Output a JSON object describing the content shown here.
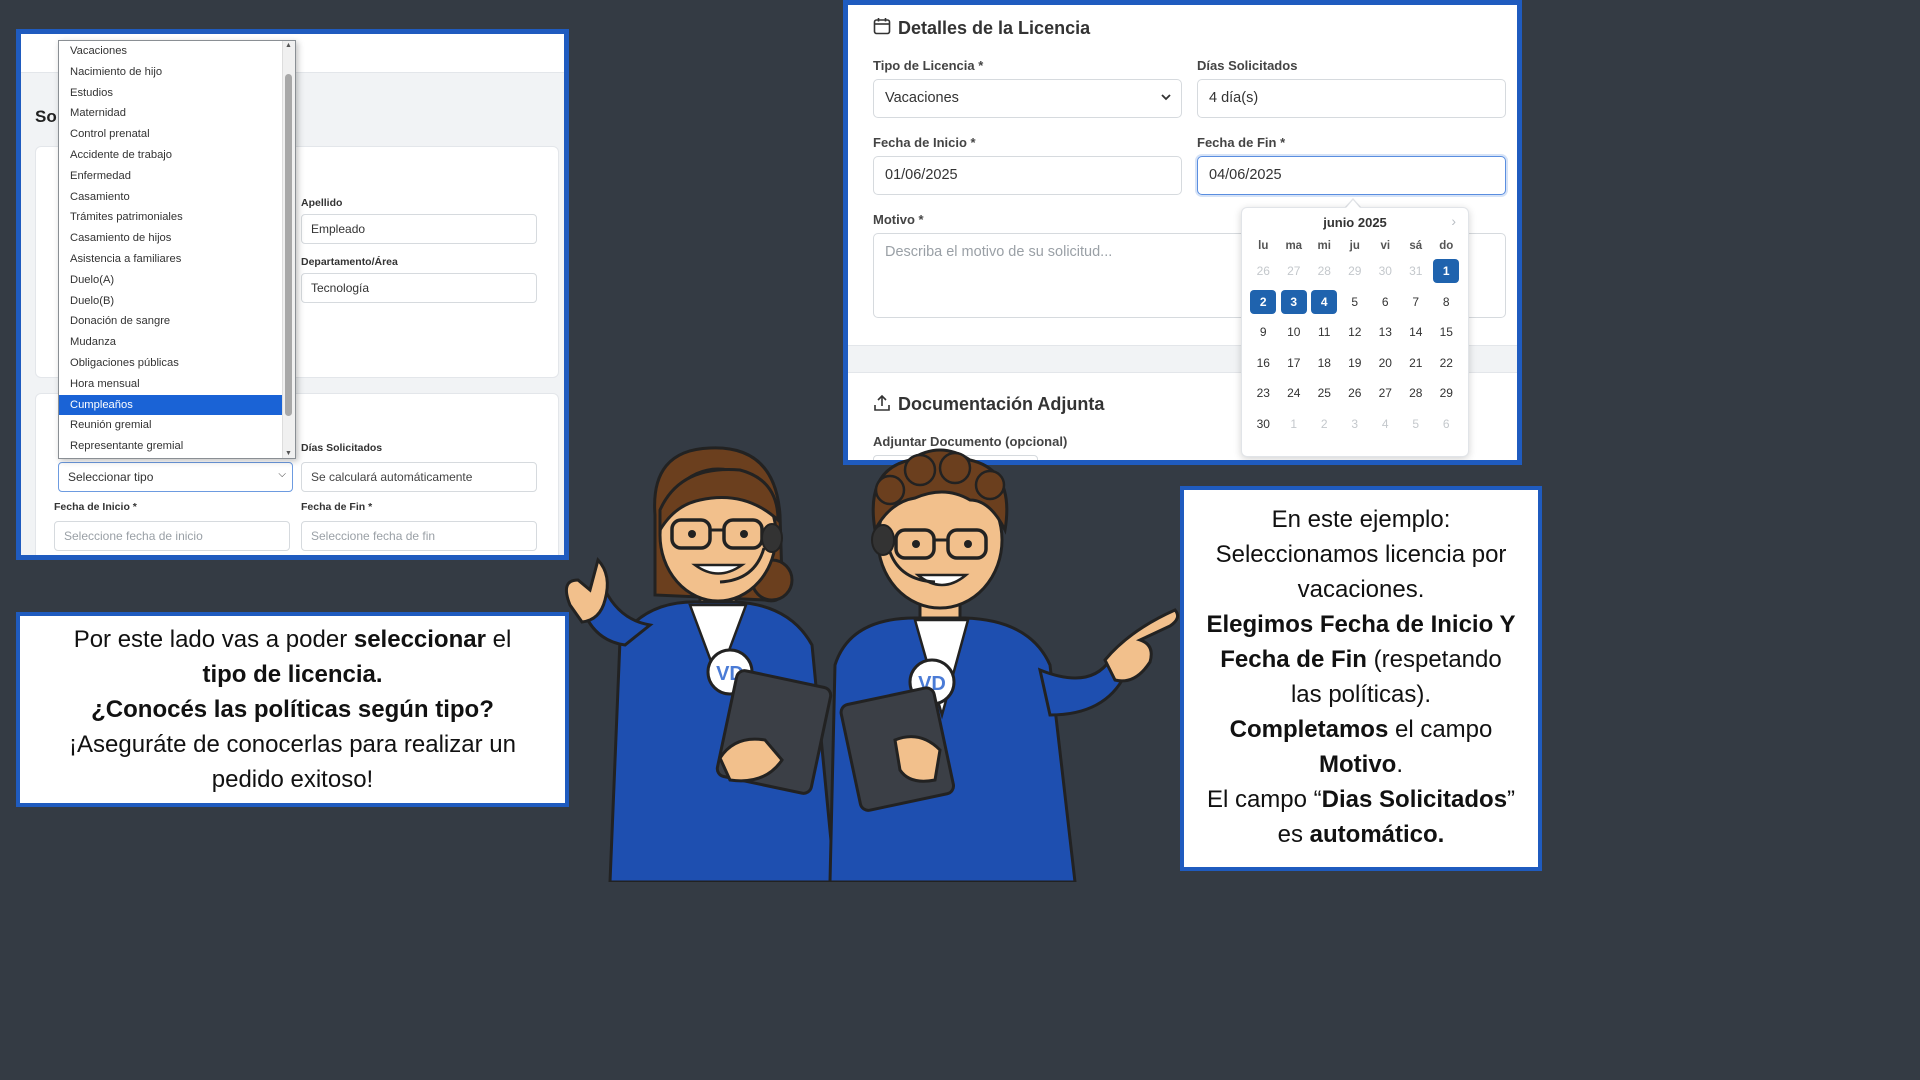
{
  "left_shot": {
    "page_title_fragment": "So",
    "dropdown_options": [
      "Vacaciones",
      "Nacimiento de hijo",
      "Estudios",
      "Maternidad",
      "Control prenatal",
      "Accidente de trabajo",
      "Enfermedad",
      "Casamiento",
      "Trámites patrimoniales",
      "Casamiento de hijos",
      "Asistencia a familiares",
      "Duelo(A)",
      "Duelo(B)",
      "Donación de sangre",
      "Mudanza",
      "Obligaciones públicas",
      "Hora mensual",
      "Cumpleaños",
      "Reunión gremial",
      "Representante gremial"
    ],
    "highlighted_option": "Cumpleaños",
    "apellido_label": "Apellido",
    "apellido_value": "Empleado",
    "departamento_label": "Departamento/Área",
    "departamento_value": "Tecnología",
    "tipo_select_value": "Seleccionar tipo",
    "dias_label": "Días Solicitados",
    "dias_placeholder": "Se calculará automáticamente",
    "fecha_inicio_label": "Fecha de Inicio *",
    "fecha_inicio_placeholder": "Seleccione fecha de inicio",
    "fecha_fin_label": "Fecha de Fin *",
    "fecha_fin_placeholder": "Seleccione fecha de fin"
  },
  "right_shot": {
    "section_title": "Detalles de la Licencia",
    "tipo_label": "Tipo de Licencia *",
    "tipo_value": "Vacaciones",
    "dias_label": "Días Solicitados",
    "dias_value": "4 día(s)",
    "fecha_inicio_label": "Fecha de Inicio *",
    "fecha_inicio_value": "01/06/2025",
    "fecha_fin_label": "Fecha de Fin *",
    "fecha_fin_value": "04/06/2025",
    "motivo_label": "Motivo *",
    "motivo_placeholder": "Describa el motivo de su solicitud...",
    "doc_section_title": "Documentación Adjunta",
    "doc_label": "Adjuntar Documento (opcional)",
    "calendar": {
      "month_title": "junio 2025",
      "weekdays": [
        "lu",
        "ma",
        "mi",
        "ju",
        "vi",
        "sá",
        "do"
      ],
      "weeks": [
        [
          "26",
          "27",
          "28",
          "29",
          "30",
          "31",
          "1"
        ],
        [
          "2",
          "3",
          "4",
          "5",
          "6",
          "7",
          "8"
        ],
        [
          "9",
          "10",
          "11",
          "12",
          "13",
          "14",
          "15"
        ],
        [
          "16",
          "17",
          "18",
          "19",
          "20",
          "21",
          "22"
        ],
        [
          "23",
          "24",
          "25",
          "26",
          "27",
          "28",
          "29"
        ],
        [
          "30",
          "1",
          "2",
          "3",
          "4",
          "5",
          "6"
        ]
      ],
      "muted_first_week_count": 6,
      "selected_days": [
        "1",
        "2",
        "3",
        "4"
      ]
    }
  },
  "left_text": {
    "l1a": "Por este lado vas a poder ",
    "l1b": "seleccionar",
    "l1c": "  el",
    "l2": "tipo de licencia.",
    "l3": "¿Conocés las políticas según tipo?",
    "l4": "¡Aseguráte de conocerlas para realizar un",
    "l5": "pedido exitoso!"
  },
  "right_text": {
    "l1": "En este ejemplo:",
    "l2": "Seleccionamos licencia por",
    "l3": "vacaciones.",
    "l4": "Elegimos Fecha de Inicio Y",
    "l5a": "Fecha de Fin",
    "l5b": " (respetando",
    "l6": "las políticas).",
    "l7a": "Completamos",
    "l7b": " el campo",
    "l8a": "Motivo",
    "l8b": ".",
    "l9a": "El campo “",
    "l9b": "Dias Solicitados",
    "l9c": "”",
    "l10a": "es ",
    "l10b": "automático."
  },
  "badges": {
    "woman": "VD",
    "man": "VD"
  },
  "colors": {
    "background": "#343b44",
    "accent": "#1f5bbf",
    "selected_day": "#1f63ae",
    "jacket": "#1e4fb0"
  }
}
